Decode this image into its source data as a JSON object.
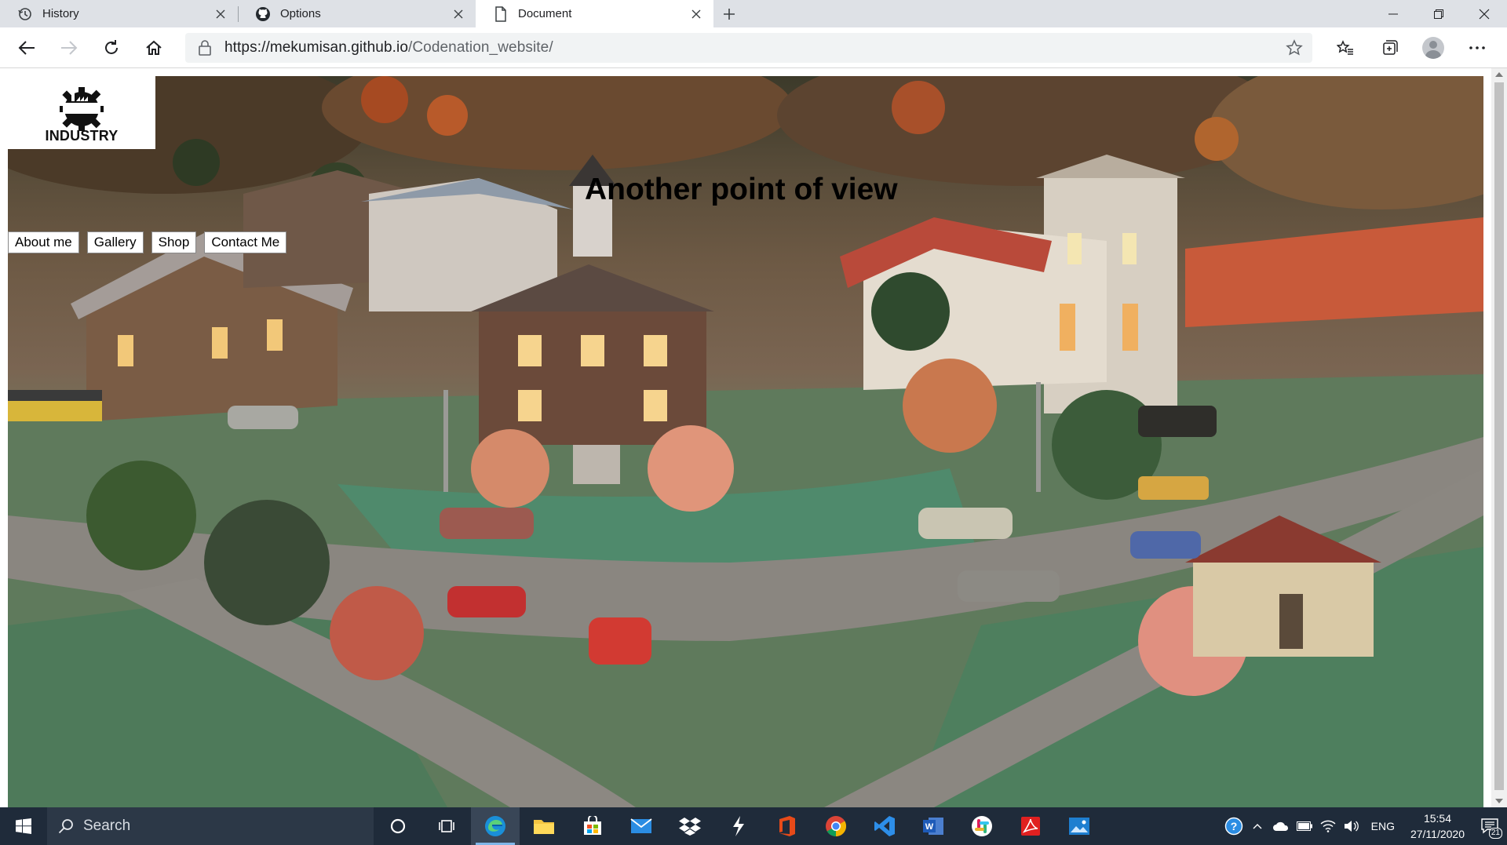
{
  "browser": {
    "tabs": [
      {
        "title": "History",
        "icon": "history-icon",
        "active": false
      },
      {
        "title": "Options",
        "icon": "github-icon",
        "active": false
      },
      {
        "title": "Document",
        "icon": "page-icon",
        "active": true
      }
    ],
    "url_domain": "https://mekumisan.github.io",
    "url_path": "/Codenation_website/"
  },
  "page": {
    "logo_text": "INDUSTRY",
    "heading": "Another point of view",
    "nav": [
      "About me",
      "Gallery",
      "Shop",
      "Contact Me"
    ],
    "hero_image": "miniature-town-model"
  },
  "taskbar": {
    "search_placeholder": "Search",
    "apps": [
      "cortana-icon",
      "task-view-icon",
      "edge-icon",
      "file-explorer-icon",
      "store-icon",
      "mail-icon",
      "dropbox-icon",
      "winamp-icon",
      "office-icon",
      "chrome-icon",
      "vscode-icon",
      "word-icon",
      "slack-icon",
      "acrobat-icon",
      "photos-icon"
    ],
    "language": "ENG",
    "time": "15:54",
    "date": "27/11/2020",
    "notifications": "21"
  },
  "colors": {
    "tabbar_bg": "#dee1e6",
    "taskbar_bg": "#1f2b3a",
    "accent": "#0078d7"
  }
}
